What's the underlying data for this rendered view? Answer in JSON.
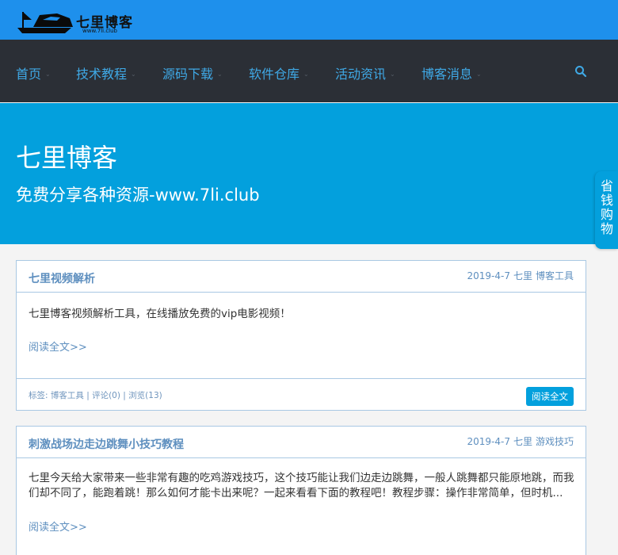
{
  "header": {
    "logo_text": "七里博客",
    "logo_url": "www.7li.club"
  },
  "nav": {
    "items": [
      {
        "label": "首页"
      },
      {
        "label": "技术教程"
      },
      {
        "label": "源码下载"
      },
      {
        "label": "软件仓库"
      },
      {
        "label": "活动资讯"
      },
      {
        "label": "博客消息"
      }
    ],
    "search_icon": "search-icon"
  },
  "hero": {
    "title": "七里博客",
    "subtitle": "免费分享各种资源-www.7li.club"
  },
  "side_tab": {
    "label": "省钱购物"
  },
  "posts": [
    {
      "title": "七里视频解析",
      "date": "2019-4-7",
      "author": "七里",
      "category": "博客工具",
      "excerpt": "七里博客视频解析工具，在线播放免费的vip电影视频！",
      "read_more": "阅读全文>>",
      "tags": "标签: 博客工具 | 评论(0) | 浏览(13)",
      "button": "阅读全文"
    },
    {
      "title": "刺激战场边走边跳舞小技巧教程",
      "date": "2019-4-7",
      "author": "七里",
      "category": "游戏技巧",
      "excerpt": "七里今天给大家带来一些非常有趣的吃鸡游戏技巧，这个技巧能让我们边走边跳舞，一般人跳舞都只能原地跳，而我们却不同了，能跑着跳！那么如何才能卡出来呢？一起来看看下面的教程吧！教程步骤：操作非常简单，但时机...",
      "read_more": "阅读全文>>"
    }
  ],
  "colors": {
    "topbar": "#1e90ec",
    "nav_bg": "#2b2f36",
    "nav_text": "#3fa9e6",
    "hero": "#03a0dd",
    "card_border": "#a9c8e3",
    "card_accent": "#5e8fbf"
  }
}
